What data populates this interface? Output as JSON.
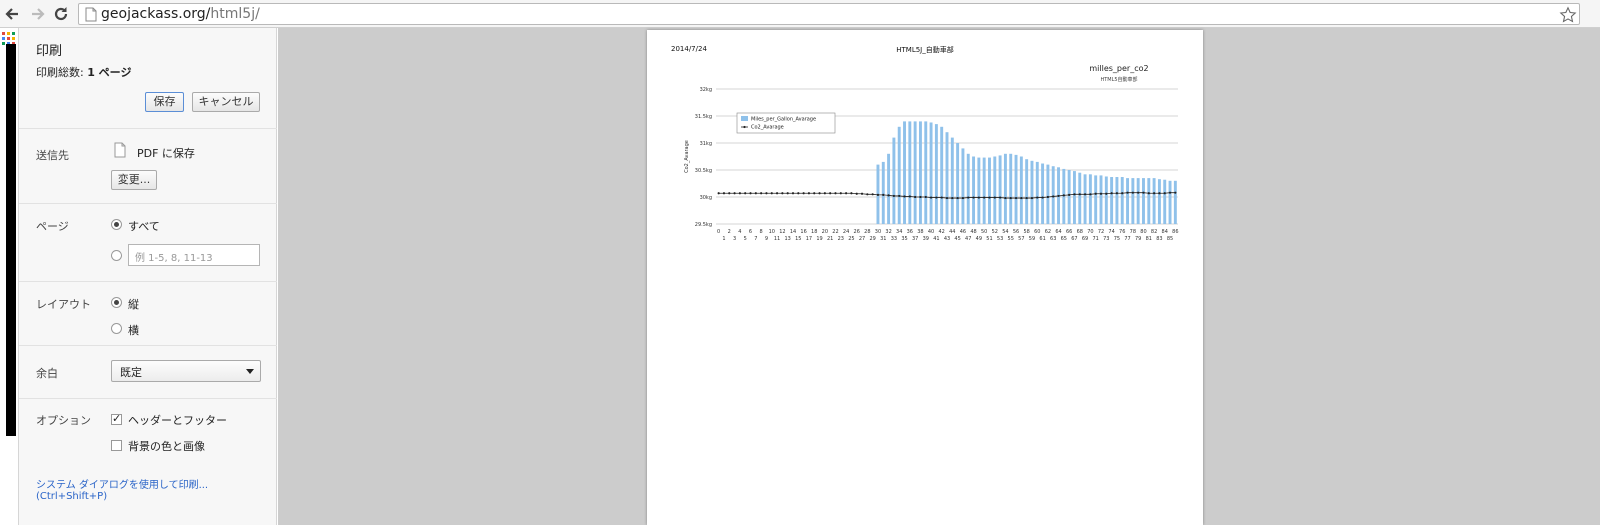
{
  "browser": {
    "url_host": "geojackass.org/",
    "url_path": "html5j/"
  },
  "print": {
    "title": "印刷",
    "total_label": "印刷総数: ",
    "total_value": "1 ページ",
    "save_label": "保存",
    "cancel_label": "キャンセル",
    "destination_label": "送信先",
    "destination_value": "PDF に保存",
    "change_label": "変更...",
    "pages_label": "ページ",
    "pages_all_label": "すべて",
    "pages_range_placeholder": "例 1-5, 8, 11-13",
    "layout_label": "レイアウト",
    "layout_portrait": "縦",
    "layout_landscape": "横",
    "margin_label": "余白",
    "margin_value": "既定",
    "options_label": "オプション",
    "option_header_footer": "ヘッダーとフッター",
    "option_background": "背景の色と画像",
    "system_dialog_link": "システム ダイアログを使用して印刷... (Ctrl+Shift+P)"
  },
  "page_preview": {
    "header_date": "2014/7/24",
    "header_title": "HTML5J_自動車部"
  },
  "chart_data": {
    "type": "bar",
    "title": "milles_per_co2",
    "subtitle": "HTML5自動車部",
    "ylabel": "Co2_Avarage",
    "xlabel": "",
    "y_tick_labels": [
      "32kg",
      "31.5kg",
      "31kg",
      "30.5kg",
      "30kg",
      "29.5kg"
    ],
    "ylim": [
      29.5,
      32
    ],
    "grid": true,
    "legend_position": "top-left",
    "colors": {
      "bar": "#8fc1ea",
      "line": "#222222"
    },
    "x": [
      0,
      1,
      2,
      3,
      4,
      5,
      6,
      7,
      8,
      9,
      10,
      11,
      12,
      13,
      14,
      15,
      16,
      17,
      18,
      19,
      20,
      21,
      22,
      23,
      24,
      25,
      26,
      27,
      28,
      29,
      30,
      31,
      32,
      33,
      34,
      35,
      36,
      37,
      38,
      39,
      40,
      41,
      42,
      43,
      44,
      45,
      46,
      47,
      48,
      49,
      50,
      51,
      52,
      53,
      54,
      55,
      56,
      57,
      58,
      59,
      60,
      61,
      62,
      63,
      64,
      65,
      66,
      67,
      68,
      69,
      70,
      71,
      72,
      73,
      74,
      75,
      76,
      77,
      78,
      79,
      80,
      81,
      82,
      83,
      84,
      85,
      86
    ],
    "series": [
      {
        "name": "Miles_per_Gallon_Avarage",
        "type": "bar",
        "values": [
          29.5,
          29.5,
          29.5,
          29.5,
          29.5,
          29.5,
          29.5,
          29.5,
          29.5,
          29.5,
          29.5,
          29.5,
          29.5,
          29.5,
          29.5,
          29.5,
          29.5,
          29.5,
          29.5,
          29.5,
          29.5,
          29.5,
          29.5,
          29.5,
          29.5,
          29.5,
          29.5,
          29.5,
          29.5,
          29.5,
          30.6,
          30.65,
          30.8,
          31.1,
          31.3,
          31.4,
          31.4,
          31.4,
          31.4,
          31.4,
          31.38,
          31.35,
          31.3,
          31.2,
          31.1,
          31.0,
          30.9,
          30.8,
          30.75,
          30.73,
          30.73,
          30.73,
          30.75,
          30.77,
          30.8,
          30.8,
          30.78,
          30.75,
          30.7,
          30.67,
          30.65,
          30.62,
          30.6,
          30.57,
          30.55,
          30.52,
          30.5,
          30.48,
          30.45,
          30.42,
          30.42,
          30.4,
          30.4,
          30.38,
          30.37,
          30.37,
          30.37,
          30.35,
          30.35,
          30.35,
          30.35,
          30.35,
          30.35,
          30.33,
          30.32,
          30.3,
          30.3
        ]
      },
      {
        "name": "Co2_Avarage",
        "type": "line",
        "values": [
          30.07,
          30.07,
          30.07,
          30.07,
          30.07,
          30.07,
          30.07,
          30.07,
          30.07,
          30.07,
          30.07,
          30.07,
          30.07,
          30.07,
          30.07,
          30.07,
          30.07,
          30.07,
          30.07,
          30.07,
          30.07,
          30.07,
          30.07,
          30.07,
          30.07,
          30.07,
          30.06,
          30.06,
          30.05,
          30.05,
          30.04,
          30.04,
          30.03,
          30.02,
          30.02,
          30.01,
          30.01,
          30.0,
          30.0,
          30.0,
          29.99,
          29.99,
          29.99,
          29.98,
          29.98,
          29.98,
          29.98,
          29.99,
          29.99,
          29.99,
          29.99,
          29.99,
          29.99,
          29.99,
          29.98,
          29.98,
          29.98,
          29.98,
          29.98,
          29.98,
          29.99,
          29.99,
          30.0,
          30.01,
          30.02,
          30.03,
          30.04,
          30.05,
          30.05,
          30.05,
          30.05,
          30.06,
          30.06,
          30.06,
          30.07,
          30.07,
          30.07,
          30.08,
          30.08,
          30.08,
          30.08,
          30.07,
          30.07,
          30.07,
          30.07,
          30.08,
          30.08
        ]
      }
    ]
  }
}
